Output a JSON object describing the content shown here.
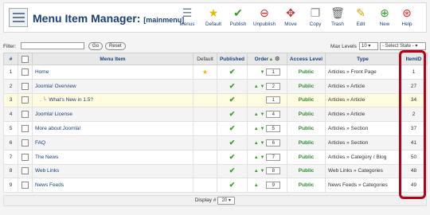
{
  "header": {
    "title": "Menu Item Manager:",
    "subtitle": "[mainmenu]",
    "toolbar": [
      {
        "label": "Menus",
        "icon": "menus-icon",
        "glyph": "☰",
        "color": "#6b7c90"
      },
      {
        "label": "Default",
        "icon": "star-icon",
        "glyph": "★",
        "color": "#f0b800"
      },
      {
        "label": "Publish",
        "icon": "publish-icon",
        "glyph": "✔",
        "color": "#3a9b2a"
      },
      {
        "label": "Unpublish",
        "icon": "unpublish-icon",
        "glyph": "⊖",
        "color": "#d22"
      },
      {
        "label": "Move",
        "icon": "move-icon",
        "glyph": "✥",
        "color": "#c33"
      },
      {
        "label": "Copy",
        "icon": "copy-icon",
        "glyph": "❐",
        "color": "#888"
      },
      {
        "label": "Trash",
        "icon": "trash-icon",
        "glyph": "🗑",
        "color": "#666"
      },
      {
        "label": "Edit",
        "icon": "edit-icon",
        "glyph": "✎",
        "color": "#d4a000"
      },
      {
        "label": "New",
        "icon": "new-icon",
        "glyph": "⊕",
        "color": "#3a9b2a"
      },
      {
        "label": "Help",
        "icon": "help-icon",
        "glyph": "⊛",
        "color": "#d22"
      }
    ]
  },
  "filter": {
    "label": "Filter:",
    "value": "",
    "go_label": "Go",
    "reset_label": "Reset",
    "max_levels_label": "Max Levels",
    "max_levels_value": "10",
    "state_value": "- Select State -"
  },
  "table": {
    "columns": [
      "#",
      "",
      "Menu Item",
      "Default",
      "Published",
      "Order",
      "Access Level",
      "Type",
      "ItemID"
    ],
    "rows": [
      {
        "num": "1",
        "title": "Home",
        "indent": "",
        "default": true,
        "up": false,
        "down": true,
        "order": "1",
        "access": "Public",
        "type": "Articles » Front Page",
        "id": "1"
      },
      {
        "num": "2",
        "title": "Joomla! Overview",
        "indent": "",
        "default": false,
        "up": true,
        "down": true,
        "order": "2",
        "access": "Public",
        "type": "Articles » Article",
        "id": "27"
      },
      {
        "num": "3",
        "title": "What's New in 1.5?",
        "indent": ".  └",
        "default": false,
        "up": false,
        "down": false,
        "order": "1",
        "access": "Public",
        "type": "Articles » Article",
        "id": "34"
      },
      {
        "num": "4",
        "title": "Joomla! License",
        "indent": "",
        "default": false,
        "up": true,
        "down": true,
        "order": "4",
        "access": "Public",
        "type": "Articles » Article",
        "id": "2"
      },
      {
        "num": "5",
        "title": "More about Joomla!",
        "indent": "",
        "default": false,
        "up": true,
        "down": true,
        "order": "5",
        "access": "Public",
        "type": "Articles » Section",
        "id": "37"
      },
      {
        "num": "6",
        "title": "FAQ",
        "indent": "",
        "default": false,
        "up": true,
        "down": true,
        "order": "6",
        "access": "Public",
        "type": "Articles » Section",
        "id": "41"
      },
      {
        "num": "7",
        "title": "The News",
        "indent": "",
        "default": false,
        "up": true,
        "down": true,
        "order": "7",
        "access": "Public",
        "type": "Articles » Category / Blog",
        "id": "50"
      },
      {
        "num": "8",
        "title": "Web Links",
        "indent": "",
        "default": false,
        "up": true,
        "down": true,
        "order": "8",
        "access": "Public",
        "type": "Web Links » Categories",
        "id": "48"
      },
      {
        "num": "9",
        "title": "News Feeds",
        "indent": "",
        "default": false,
        "up": true,
        "down": false,
        "order": "9",
        "access": "Public",
        "type": "News Feeds » Categories",
        "id": "49"
      }
    ]
  },
  "footer": {
    "display_label": "Display #",
    "display_value": "20"
  },
  "colors": {
    "link": "#1b3f78",
    "published": "#3a9b2a",
    "highlight": "#b3001b"
  }
}
